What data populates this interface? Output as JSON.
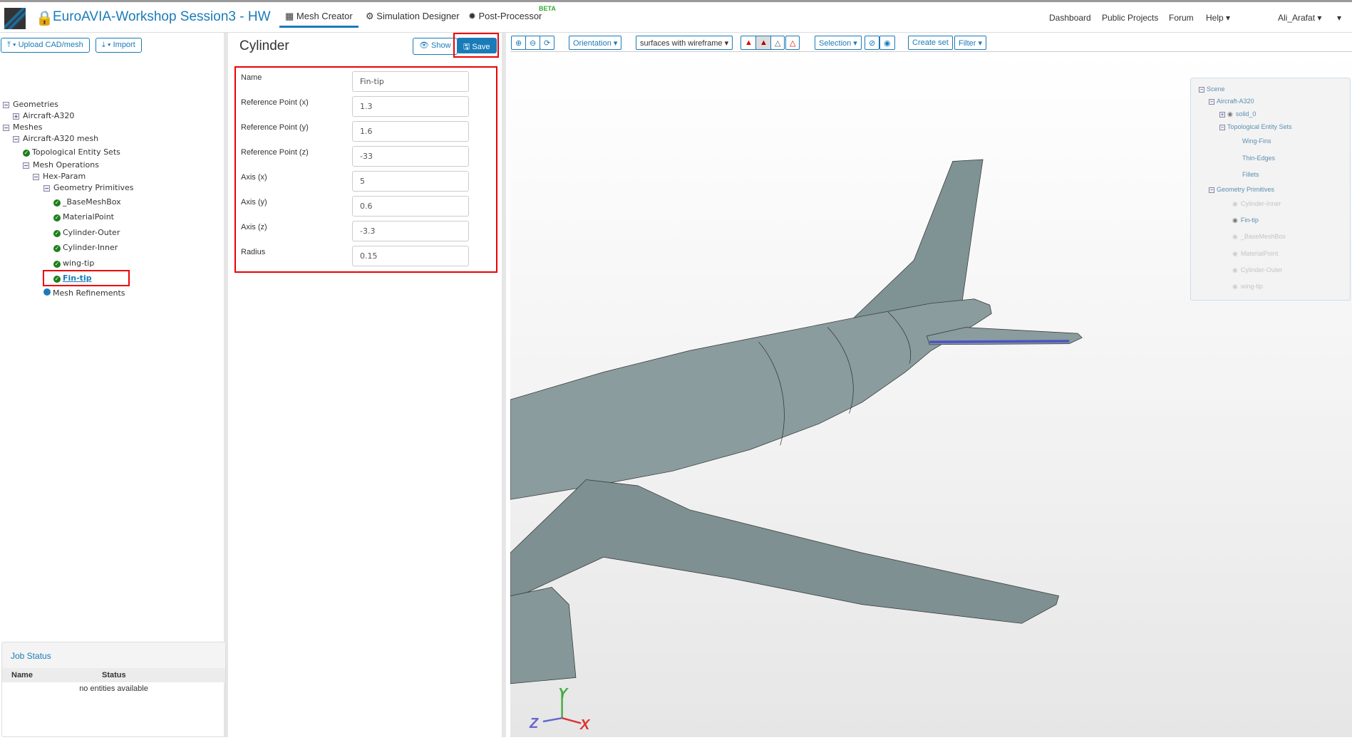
{
  "header": {
    "title": "EuroAVIA-Workshop Session3 - HW",
    "tabs": [
      {
        "label": "Mesh Creator",
        "icon": "grid-icon"
      },
      {
        "label": "Simulation Designer",
        "icon": "gears-icon"
      },
      {
        "label": "Post-Processor",
        "icon": "cog-icon"
      }
    ],
    "beta": "BETA",
    "links": [
      "Dashboard",
      "Public Projects",
      "Forum",
      "Help ▾"
    ],
    "user": "Ali_Arafat ▾",
    "extra": "▾"
  },
  "left": {
    "upload": "⤒ ▾ Upload CAD/mesh",
    "import": "⤓ ▾ Import",
    "tree": [
      "Geometries",
      "Aircraft-A320",
      "Meshes",
      "Aircraft-A320 mesh",
      "Topological Entity Sets",
      "Mesh Operations",
      "Hex-Param",
      "Geometry Primitives",
      "_BaseMeshBox",
      "MaterialPoint",
      "Cylinder-Outer",
      "Cylinder-Inner",
      "wing-tip",
      "Fin-tip",
      "Mesh Refinements"
    ],
    "job": {
      "title": "Job Status",
      "cols": [
        "Name",
        "Status"
      ],
      "empty": "no entities available"
    }
  },
  "panel": {
    "title": "Cylinder",
    "show": "👁 Show",
    "save": "🖫 Save",
    "fields": [
      {
        "label": "Name",
        "value": "Fin-tip"
      },
      {
        "label": "Reference Point (x)",
        "value": "1.3"
      },
      {
        "label": "Reference Point (y)",
        "value": "1.6"
      },
      {
        "label": "Reference Point (z)",
        "value": "-33"
      },
      {
        "label": "Axis (x)",
        "value": "5"
      },
      {
        "label": "Axis (y)",
        "value": "0.6"
      },
      {
        "label": "Axis (z)",
        "value": "-3.3"
      },
      {
        "label": "Radius",
        "value": "0.15"
      }
    ]
  },
  "toolbar": {
    "orientation": "Orientation ▾",
    "render_mode": "surfaces with wireframe ▾",
    "selection": "Selection ▾",
    "create_set": "Create set",
    "filter": "Filter ▾"
  },
  "scene": {
    "items": [
      "Scene",
      "Aircraft-A320",
      "solid_0",
      "Topological Entity Sets",
      "Wing-Fins",
      "Thin-Edges",
      "Fillets",
      "Geometry Primitives",
      "Cylinder-Inner",
      "Fin-tip",
      "_BaseMeshBox",
      "MaterialPoint",
      "Cylinder-Outer",
      "wing-tip"
    ]
  },
  "axes": {
    "x": "X",
    "y": "Y",
    "z": "Z"
  }
}
